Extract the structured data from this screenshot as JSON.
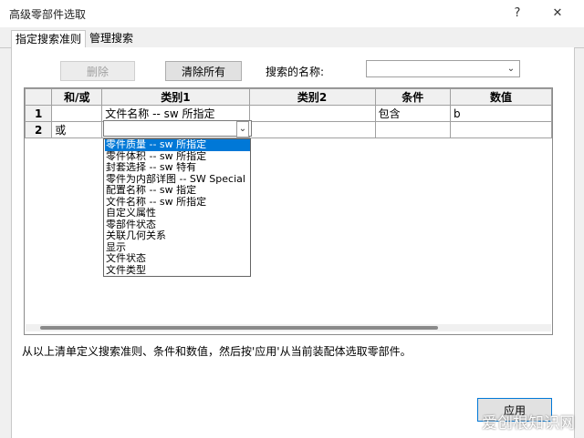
{
  "window": {
    "title": "高级零部件选取",
    "help_glyph": "?",
    "close_glyph": "✕"
  },
  "tabs": [
    {
      "label": "指定搜索准则"
    },
    {
      "label": "管理搜索"
    }
  ],
  "toolbar": {
    "delete_label": "删除",
    "clear_all_label": "清除所有",
    "search_name_label": "搜索的名称:",
    "search_name_value": ""
  },
  "grid": {
    "headers": [
      "和/或",
      "类别1",
      "类别2",
      "条件",
      "数值"
    ],
    "rows": [
      {
        "num": "1",
        "andor": "",
        "cat1": "文件名称 -- sw 所指定",
        "cat2": "",
        "cond": "包含",
        "value": "b"
      },
      {
        "num": "2",
        "andor": "或",
        "cat1": "",
        "cat2": "",
        "cond": "",
        "value": ""
      }
    ]
  },
  "dropdown": {
    "items": [
      "零件质量 -- sw 所指定",
      "零件体积 -- sw 所指定",
      "封套选择 -- sw 特有",
      "零件为内部详图 -- SW Special",
      "配置名称 -- sw 指定",
      "文件名称 -- sw 所指定",
      "自定义属性",
      "零部件状态",
      "关联几何关系",
      "显示",
      "文件状态",
      "文件类型"
    ],
    "selected_index": 0
  },
  "hint_text": "从以上清单定义搜索准则、条件和数值，然后按'应用'从当前装配体选取零部件。",
  "apply_label": "应用",
  "watermark": "爱创根知识网"
}
